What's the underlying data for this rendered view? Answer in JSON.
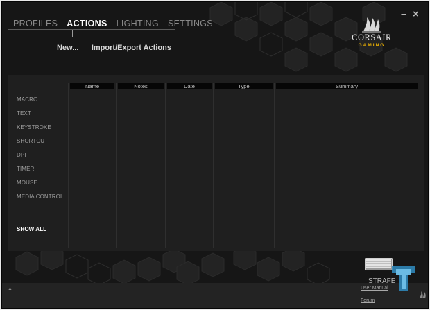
{
  "nav": {
    "tabs": [
      {
        "label": "PROFILES",
        "active": false
      },
      {
        "label": "ACTIONS",
        "active": true
      },
      {
        "label": "LIGHTING",
        "active": false
      },
      {
        "label": "SETTINGS",
        "active": false
      }
    ]
  },
  "actions_toolbar": {
    "new_label": "New...",
    "import_export_label": "Import/Export Actions"
  },
  "window_controls": {
    "minimize": "–",
    "close": "×"
  },
  "brand": {
    "name": "CORSAIR",
    "tagline": "GAMING",
    "accent": "#f0b400"
  },
  "categories": [
    "MACRO",
    "TEXT",
    "KEYSTROKE",
    "SHORTCUT",
    "DPI",
    "TIMER",
    "MOUSE",
    "MEDIA CONTROL"
  ],
  "show_all_label": "SHOW ALL",
  "table": {
    "columns": [
      "Name",
      "Notes",
      "Date",
      "Type",
      "Summary"
    ],
    "rows": []
  },
  "device": {
    "name": "STRAFE",
    "icon": "keyboard-icon"
  },
  "footer": {
    "user_manual": "User Manual",
    "forum": "Forum"
  },
  "colors": {
    "background": "#161616",
    "panel": "#1f1f1f",
    "header": "#060606"
  }
}
